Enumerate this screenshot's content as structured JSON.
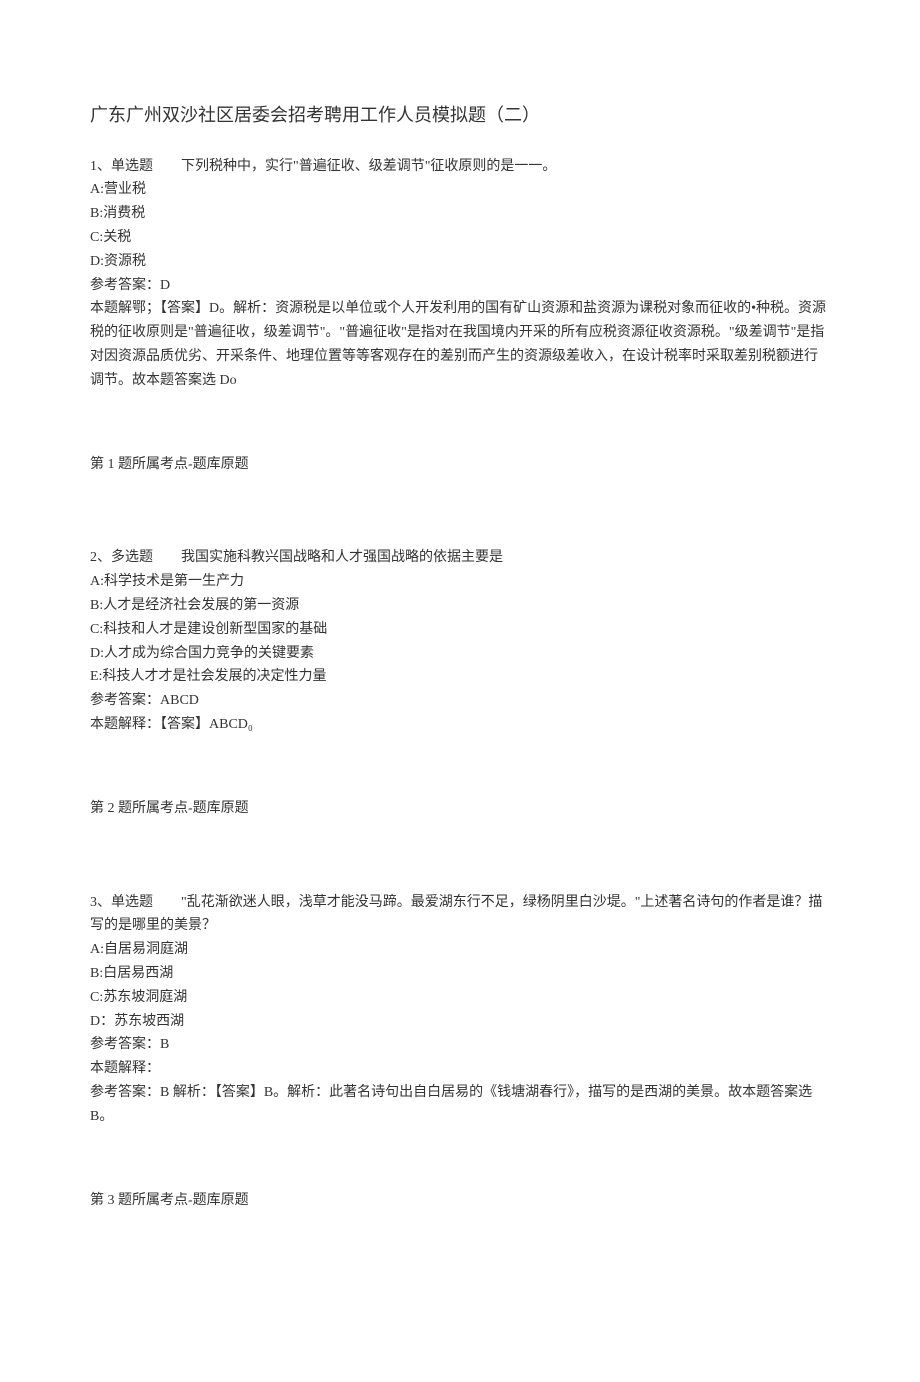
{
  "title": "广东广州双沙社区居委会招考聘用工作人员模拟题（二）",
  "q1": {
    "stem": "1、单选题　　下列税种中，实行\"普遍征收、级差调节\"征收原则的是一一。",
    "optA": "A:营业税",
    "optB": "B:消费税",
    "optC": "C:关税",
    "optD": "D:资源税",
    "answerRef": "参考答案：D",
    "explanation": "本题解鄂；【答案】D。解析：资源税是以单位或个人开发利用的国有矿山资源和盐资源为课税对象而征收的•种税。资源税的征收原则是\"普遍征收，级差调节\"。\"普遍征收\"是指对在我国境内开采的所有应税资源征收资源税。\"级差调节\"是指对因资源品质优劣、开采条件、地理位置等等客观存在的差别而产生的资源级差收入，在设计税率时采取差别税额进行调节。故本题答案选 Do",
    "topic": "第 1 题所属考点-题库原题"
  },
  "q2": {
    "stem": "2、多选题　　我国实施科教兴国战略和人才强国战略的依据主要是",
    "optA": "A:科学技术是第一生产力",
    "optB": "B:人才是经济社会发展的第一资源",
    "optC": "C:科技和人才是建设创新型国家的基础",
    "optD": "D:人才成为综合国力竞争的关键要素",
    "optE": "E:科技人才才是社会发展的决定性力量",
    "answerRef": "参考答案：ABCD",
    "explanation": "本题解释：【答案】ABCD₀",
    "topic": "第 2 题所属考点-题库原题"
  },
  "q3": {
    "stem": "3、单选题　　\"乱花渐欲迷人眼，浅草才能没马蹄。最爱湖东行不足，绿杨阴里白沙堤。\"上述著名诗句的作者是谁？描写的是哪里的美景？",
    "optA": "A:自居易洞庭湖",
    "optB": "B:白居易西湖",
    "optC": "C:苏东坡洞庭湖",
    "optD": "D：苏东坡西湖",
    "answerRef": "参考答案：B",
    "explLabel": "本题解释：",
    "explanation": "参考答案：B 解析：【答案】B。解析：此著名诗句出自白居易的《钱塘湖春行》，描写的是西湖的美景。故本题答案选 B。",
    "topic": "第 3 题所属考点-题库原题"
  }
}
